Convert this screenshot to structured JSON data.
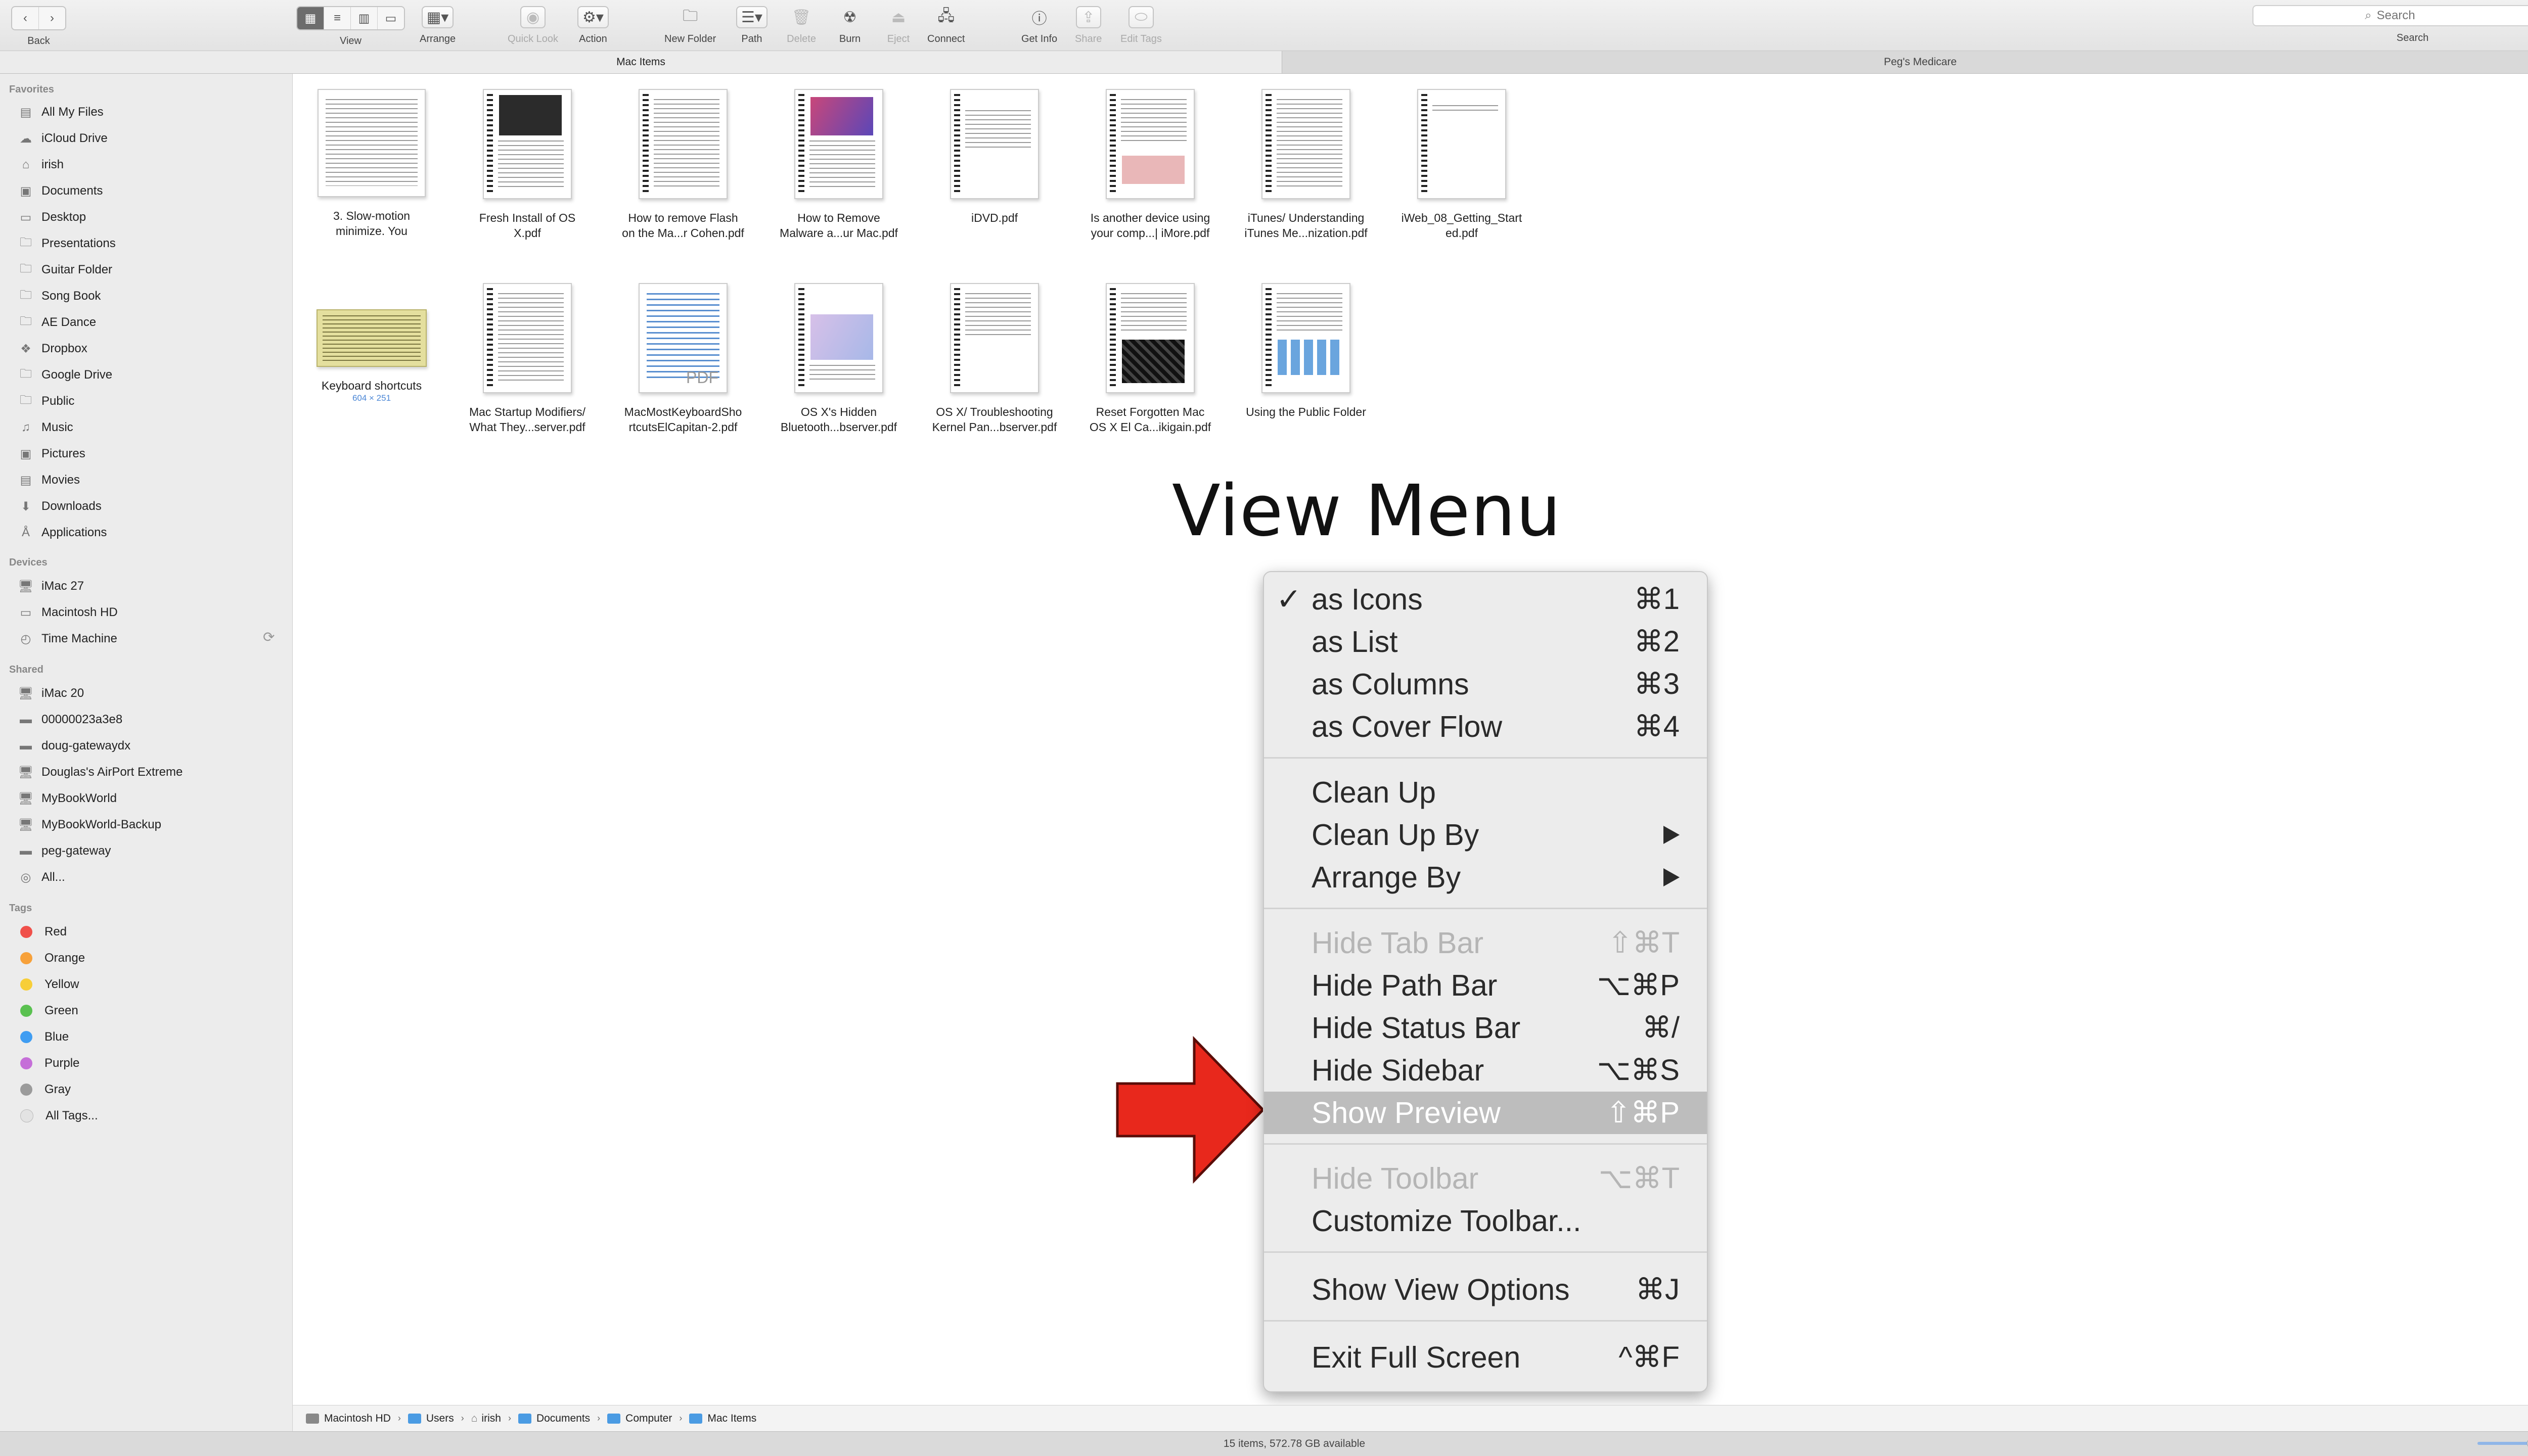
{
  "toolbar": {
    "back_label": "Back",
    "view_label": "View",
    "arrange_label": "Arrange",
    "quicklook_label": "Quick Look",
    "action_label": "Action",
    "newfolder_label": "New Folder",
    "path_label": "Path",
    "delete_label": "Delete",
    "burn_label": "Burn",
    "eject_label": "Eject",
    "connect_label": "Connect",
    "getinfo_label": "Get Info",
    "share_label": "Share",
    "edittags_label": "Edit Tags",
    "search_placeholder": "Search",
    "search_label": "Search"
  },
  "tabs": [
    {
      "label": "Mac Items",
      "active": true
    },
    {
      "label": "Peg's Medicare",
      "active": false
    }
  ],
  "sidebar": {
    "favorites_title": "Favorites",
    "favorites": [
      {
        "label": "All My Files",
        "icon": "all-files-icon"
      },
      {
        "label": "iCloud Drive",
        "icon": "cloud-icon"
      },
      {
        "label": "irish",
        "icon": "home-icon"
      },
      {
        "label": "Documents",
        "icon": "documents-icon"
      },
      {
        "label": "Desktop",
        "icon": "desktop-icon"
      },
      {
        "label": "Presentations",
        "icon": "folder-icon"
      },
      {
        "label": "Guitar Folder",
        "icon": "folder-icon"
      },
      {
        "label": "Song Book",
        "icon": "folder-icon"
      },
      {
        "label": "AE Dance",
        "icon": "folder-icon"
      },
      {
        "label": "Dropbox",
        "icon": "dropbox-icon"
      },
      {
        "label": "Google Drive",
        "icon": "folder-icon"
      },
      {
        "label": "Public",
        "icon": "folder-icon"
      },
      {
        "label": "Music",
        "icon": "music-icon"
      },
      {
        "label": "Pictures",
        "icon": "camera-icon"
      },
      {
        "label": "Movies",
        "icon": "film-icon"
      },
      {
        "label": "Downloads",
        "icon": "download-icon"
      },
      {
        "label": "Applications",
        "icon": "applications-icon"
      }
    ],
    "devices_title": "Devices",
    "devices": [
      {
        "label": "iMac 27",
        "icon": "monitor-icon"
      },
      {
        "label": "Macintosh HD",
        "icon": "hard-drive-icon"
      },
      {
        "label": "Time Machine",
        "icon": "time-machine-icon"
      }
    ],
    "shared_title": "Shared",
    "shared": [
      {
        "label": "iMac 20",
        "icon": "monitor-icon"
      },
      {
        "label": "00000023a3e8",
        "icon": "server-icon"
      },
      {
        "label": "doug-gatewaydx",
        "icon": "server-icon"
      },
      {
        "label": "Douglas's AirPort Extreme",
        "icon": "monitor-icon"
      },
      {
        "label": "MyBookWorld",
        "icon": "monitor-icon"
      },
      {
        "label": "MyBookWorld-Backup",
        "icon": "monitor-icon"
      },
      {
        "label": "peg-gateway",
        "icon": "server-icon"
      },
      {
        "label": "All...",
        "icon": "network-icon"
      }
    ],
    "tags_title": "Tags",
    "tags": [
      {
        "label": "Red",
        "color": "#f0504a"
      },
      {
        "label": "Orange",
        "color": "#f7a13a"
      },
      {
        "label": "Yellow",
        "color": "#f7ce38"
      },
      {
        "label": "Green",
        "color": "#5ac150"
      },
      {
        "label": "Blue",
        "color": "#3f9df2"
      },
      {
        "label": "Purple",
        "color": "#c56fd8"
      },
      {
        "label": "Gray",
        "color": "#9b9b9b"
      },
      {
        "label": "All Tags...",
        "color": "#dddddd"
      }
    ]
  },
  "files": [
    {
      "line1": "3. Slow-motion",
      "line2": "minimize. You",
      "sub": ""
    },
    {
      "line1": "Fresh Install of OS",
      "line2": "X.pdf",
      "sub": ""
    },
    {
      "line1": "How to remove Flash",
      "line2": "on the Ma...r Cohen.pdf",
      "sub": ""
    },
    {
      "line1": "How to Remove",
      "line2": "Malware a...ur Mac.pdf",
      "sub": ""
    },
    {
      "line1": "iDVD.pdf",
      "line2": "",
      "sub": ""
    },
    {
      "line1": "Is another device using",
      "line2": "your comp...| iMore.pdf",
      "sub": ""
    },
    {
      "line1": "iTunes/ Understanding",
      "line2": "iTunes Me...nization.pdf",
      "sub": ""
    },
    {
      "line1": "iWeb_08_Getting_Start",
      "line2": "ed.pdf",
      "sub": ""
    },
    {
      "line1": "Keyboard shortcuts",
      "line2": "",
      "sub": "604 × 251"
    },
    {
      "line1": "Mac Startup Modifiers/",
      "line2": "What They...server.pdf",
      "sub": ""
    },
    {
      "line1": "MacMostKeyboardSho",
      "line2": "rtcutsElCapitan-2.pdf",
      "sub": ""
    },
    {
      "line1": "OS X's Hidden",
      "line2": "Bluetooth...bserver.pdf",
      "sub": ""
    },
    {
      "line1": "OS X/ Troubleshooting",
      "line2": "Kernel Pan...bserver.pdf",
      "sub": ""
    },
    {
      "line1": "Reset Forgotten Mac",
      "line2": "OS X El Ca...ikigain.pdf",
      "sub": ""
    },
    {
      "line1": "Using the Public Folder",
      "line2": "",
      "sub": ""
    }
  ],
  "pdf_badge": "PDF",
  "overlay_title": "View Menu",
  "menu": {
    "items": [
      {
        "label": "as Icons",
        "shortcut": "⌘1",
        "checked": "✓"
      },
      {
        "label": "as List",
        "shortcut": "⌘2"
      },
      {
        "label": "as Columns",
        "shortcut": "⌘3"
      },
      {
        "label": "as Cover Flow",
        "shortcut": "⌘4"
      },
      {
        "label": "Clean Up",
        "shortcut": ""
      },
      {
        "label": "Clean Up By",
        "shortcut": ""
      },
      {
        "label": "Arrange By",
        "shortcut": ""
      },
      {
        "label": "Hide Tab Bar",
        "shortcut": "⇧⌘T"
      },
      {
        "label": "Hide Path Bar",
        "shortcut": "⌥⌘P"
      },
      {
        "label": "Hide Status Bar",
        "shortcut": "⌘/"
      },
      {
        "label": "Hide Sidebar",
        "shortcut": "⌥⌘S"
      },
      {
        "label": "Show Preview",
        "shortcut": "⇧⌘P"
      },
      {
        "label": "Hide Toolbar",
        "shortcut": "⌥⌘T"
      },
      {
        "label": "Customize Toolbar...",
        "shortcut": ""
      },
      {
        "label": "Show View Options",
        "shortcut": "⌘J"
      },
      {
        "label": "Exit Full Screen",
        "shortcut": "^⌘F"
      }
    ]
  },
  "pathbar": [
    "Macintosh HD",
    "Users",
    "irish",
    "Documents",
    "Computer",
    "Mac Items"
  ],
  "status": "15 items, 572.78 GB available",
  "colors": {
    "arrow": "#e8281c",
    "highlight": "#bdbdbd",
    "accent": "#4a9be3"
  }
}
